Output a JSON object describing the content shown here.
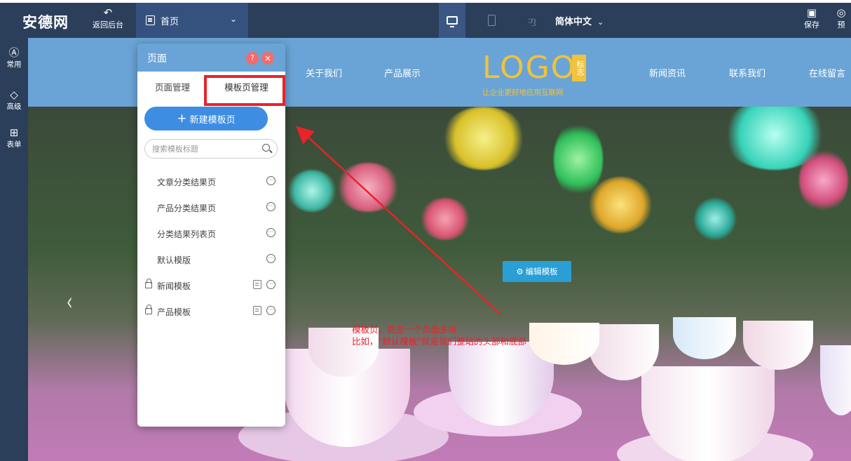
{
  "toolbar": {
    "logo": "安德网",
    "back_label": "返回后台",
    "page_select": "首页",
    "language": "简体中文",
    "save_label": "保存",
    "preview_label": "预"
  },
  "sidebar": {
    "items": [
      {
        "icon": "A",
        "label": "常用"
      },
      {
        "icon": "gem-icon",
        "label": "高级"
      },
      {
        "icon": "form-icon",
        "label": "表单"
      }
    ]
  },
  "site": {
    "nav": [
      "关于我们",
      "产品展示",
      "新闻资讯",
      "联系我们",
      "在线留言"
    ],
    "logo_text": "LOGO",
    "logo_badge": "标志",
    "slogan": "让企业更好地应用互联网"
  },
  "banner": {
    "edit_button": "编辑模板",
    "annotation_line1": "模板页，就是一个页面多用",
    "annotation_line2": "比如，\"默认模板\"就是我们整站的头部和底部"
  },
  "panel": {
    "title": "页面",
    "help": "?",
    "close": "×",
    "tabs": [
      "页面管理",
      "模板页管理"
    ],
    "new_button": "新建模板页",
    "search_placeholder": "搜索模板标题",
    "templates": [
      {
        "name": "文章分类结果页",
        "locked": false
      },
      {
        "name": "产品分类结果页",
        "locked": false
      },
      {
        "name": "分类结果列表页",
        "locked": false
      },
      {
        "name": "默认模版",
        "locked": false
      },
      {
        "name": "新闻模板",
        "locked": true
      },
      {
        "name": "产品模板",
        "locked": true
      }
    ]
  },
  "colors": {
    "toolbar": "#2b3e5a",
    "header": "#6aa4d6",
    "accent": "#3d8ee2",
    "highlight": "#e8232a",
    "logo": "#f1c23b"
  }
}
